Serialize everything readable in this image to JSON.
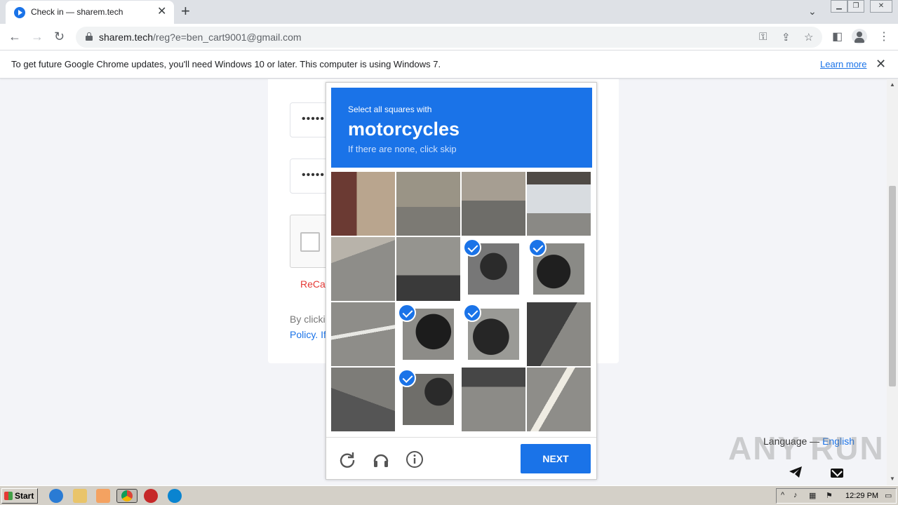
{
  "browser": {
    "tab_title": "Check in — sharem.tech",
    "url_host": "sharem.tech",
    "url_path": "/reg?e=ben_cart9001@gmail.com"
  },
  "infobar": {
    "message": "To get future Google Chrome updates, you'll need Windows 10 or later. This computer is using Windows 7.",
    "learn_more": "Learn more"
  },
  "form": {
    "password_mask": "•••••",
    "confirm_mask": "•••••",
    "recaptcha_label": "ReCap",
    "terms_line1": "By clicki",
    "terms_line2": "Policy. If"
  },
  "captcha": {
    "prompt": "Select all squares with",
    "object": "motorcycles",
    "skip_hint": "If there are none, click skip",
    "next_label": "NEXT",
    "tiles": [
      {
        "selected": false,
        "scene": "building-door"
      },
      {
        "selected": false,
        "scene": "shopfront"
      },
      {
        "selected": false,
        "scene": "bin-riders-helmets"
      },
      {
        "selected": false,
        "scene": "white-van"
      },
      {
        "selected": false,
        "scene": "road-curb"
      },
      {
        "selected": false,
        "scene": "road-mirror"
      },
      {
        "selected": true,
        "scene": "riders"
      },
      {
        "selected": true,
        "scene": "motorcycle-side"
      },
      {
        "selected": false,
        "scene": "road-lines"
      },
      {
        "selected": true,
        "scene": "motorcycle-front"
      },
      {
        "selected": true,
        "scene": "motorcycle-body"
      },
      {
        "selected": false,
        "scene": "road-shadow"
      },
      {
        "selected": false,
        "scene": "road-shadow-2"
      },
      {
        "selected": true,
        "scene": "motorcycle-wheel"
      },
      {
        "selected": false,
        "scene": "road-plain"
      },
      {
        "selected": false,
        "scene": "road-lane"
      }
    ]
  },
  "footer": {
    "language_label": "Language — ",
    "language_value": "English",
    "watermark": "ANY RUN"
  },
  "taskbar": {
    "start": "Start",
    "clock": "12:29 PM"
  },
  "colors": {
    "accent": "#1a73e8",
    "error": "#e53935"
  }
}
